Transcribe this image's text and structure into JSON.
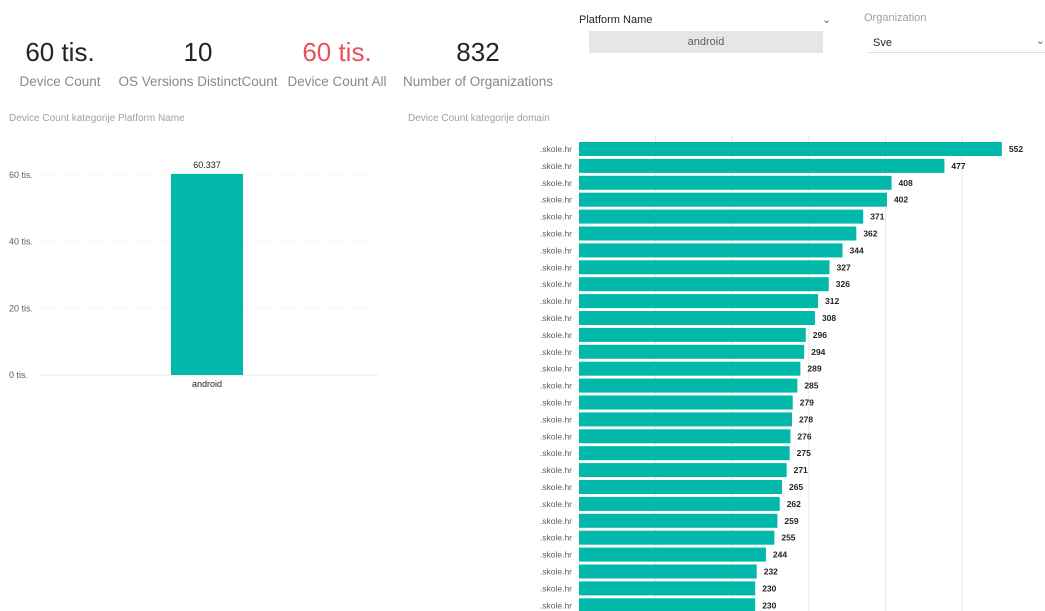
{
  "kpis": [
    {
      "value": "60 tis.",
      "label": "Device Count",
      "color": "#252423"
    },
    {
      "value": "10",
      "label": "OS Versions DistinctCount",
      "color": "#252423"
    },
    {
      "value": "60 tis.",
      "label": "Device Count All",
      "color": "#e8505b"
    },
    {
      "value": "832",
      "label": "Number of Organizations",
      "color": "#252423"
    }
  ],
  "slicers": {
    "platform": {
      "title": "Platform Name",
      "selected": "android"
    },
    "organization": {
      "title": "Organization",
      "selected": "Sve"
    }
  },
  "colors": {
    "bar": "#01b8aa",
    "grid": "#e8e8e8",
    "text": "#605e5c"
  },
  "chart_data": [
    {
      "type": "bar",
      "title": "Device Count kategorije Platform Name",
      "categories": [
        "android"
      ],
      "values": [
        60337
      ],
      "data_labels": [
        "60.337"
      ],
      "yticks": [
        "0 tis.",
        "20 tis.",
        "40 tis.",
        "60 tis."
      ],
      "ylim": [
        0,
        66000
      ],
      "grid": true
    },
    {
      "type": "bar",
      "orientation": "horizontal",
      "title": "Device Count kategorije domain",
      "categories": [
        ".skole.hr",
        ".skole.hr",
        ".skole.hr",
        ".skole.hr",
        ".skole.hr",
        ".skole.hr",
        ".skole.hr",
        ".skole.hr",
        ".skole.hr",
        ".skole.hr",
        ".skole.hr",
        ".skole.hr",
        ".skole.hr",
        ".skole.hr",
        ".skole.hr",
        ".skole.hr",
        ".skole.hr",
        ".skole.hr",
        ".skole.hr",
        ".skole.hr",
        ".skole.hr",
        ".skole.hr",
        ".skole.hr",
        ".skole.hr",
        ".skole.hr",
        ".skole.hr",
        ".skole.hr",
        ".skole.hr"
      ],
      "values": [
        552,
        477,
        408,
        402,
        371,
        362,
        344,
        327,
        326,
        312,
        308,
        296,
        294,
        289,
        285,
        279,
        278,
        276,
        275,
        271,
        265,
        262,
        259,
        255,
        244,
        232,
        230,
        230
      ],
      "xlim": [
        0,
        560
      ],
      "grid": true
    }
  ]
}
